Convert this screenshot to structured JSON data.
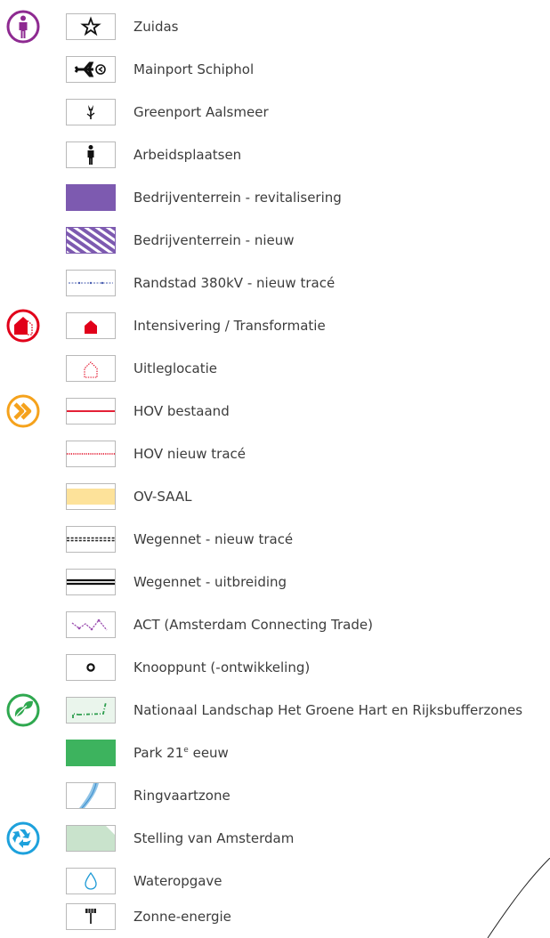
{
  "legend": {
    "items": [
      {
        "label": "Zuidas",
        "icon": "star-icon",
        "category_icon": "person-icon",
        "category_color": "#8e2a91"
      },
      {
        "label": "Mainport Schiphol",
        "icon": "airplane-icon"
      },
      {
        "label": "Greenport Aalsmeer",
        "icon": "flower-icon"
      },
      {
        "label": "Arbeidsplaatsen",
        "icon": "person-icon"
      },
      {
        "label": "Bedrijventerrein - revitalisering",
        "icon": "purple-fill-swatch",
        "color": "#7d5ab0"
      },
      {
        "label": "Bedrijventerrein - nieuw",
        "icon": "purple-hatch-swatch",
        "color": "#7d5ab0"
      },
      {
        "label": "Randstad 380kV - nieuw tracé",
        "icon": "dashed-blue-line-swatch",
        "color": "#4a5fb0"
      },
      {
        "label": "Intensivering / Transformatie",
        "icon": "red-house-icon",
        "category_icon": "red-house-circle-icon",
        "category_color": "#e1001a",
        "color": "#e1001a"
      },
      {
        "label": "Uitleglocatie",
        "icon": "dotted-house-icon",
        "color": "#e1001a"
      },
      {
        "label": "HOV bestaand",
        "icon": "red-line-swatch",
        "category_icon": "double-chevron-icon",
        "category_color": "#f5a21c",
        "color": "#e1001a"
      },
      {
        "label": "HOV nieuw tracé",
        "icon": "red-dotted-line-swatch",
        "color": "#e1001a"
      },
      {
        "label": "OV-SAAL",
        "icon": "yellow-band-swatch",
        "color": "#fde29a"
      },
      {
        "label": "Wegennet - nieuw tracé",
        "icon": "dashed-road-swatch"
      },
      {
        "label": "Wegennet - uitbreiding",
        "icon": "double-road-swatch"
      },
      {
        "label": "ACT (Amsterdam Connecting Trade)",
        "icon": "purple-zigzag-swatch",
        "color": "#9b4fb0"
      },
      {
        "label": "Knooppunt (-ontwikkeling)",
        "icon": "ring-node-icon"
      },
      {
        "label": "Nationaal Landschap Het Groene Hart en Rijksbufferzones",
        "icon": "green-dashed-boundary-swatch",
        "category_icon": "leaf-icon",
        "category_color": "#2fa84f",
        "color": "#2e9e4e"
      },
      {
        "label_main": "Park 21",
        "label_sup": "e",
        "label_tail": " eeuw",
        "icon": "green-fill-swatch",
        "color": "#3db35e"
      },
      {
        "label": "Ringvaartzone",
        "icon": "blue-river-swatch",
        "color": "#8fc3e6"
      },
      {
        "label": "Stelling van Amsterdam",
        "icon": "light-green-fill-swatch",
        "category_icon": "recycle-icon",
        "category_color": "#1da1dc",
        "color": "#c9e3cc"
      },
      {
        "label": "Wateropgave",
        "icon": "water-drop-icon",
        "color": "#1e9ad6"
      },
      {
        "label": "Zonne-energie",
        "icon": "solar-panel-icon"
      }
    ]
  }
}
